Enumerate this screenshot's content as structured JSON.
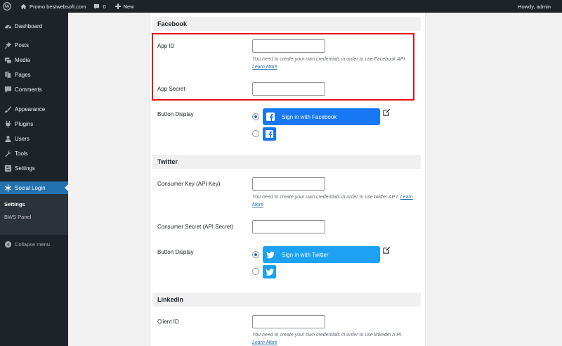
{
  "adminbar": {
    "site_name": "Promo bestwebsoft.com",
    "comments_count": "0",
    "new_label": "New",
    "howdy": "Howdy, admin",
    "icons": [
      "wordpress-logo-icon",
      "home-icon",
      "comment-icon",
      "plus-icon"
    ]
  },
  "sidebar": {
    "items": [
      {
        "label": "Dashboard",
        "icon": "dashboard-icon"
      },
      {
        "label": "Posts",
        "icon": "pin-icon"
      },
      {
        "label": "Media",
        "icon": "media-icon"
      },
      {
        "label": "Pages",
        "icon": "pages-icon"
      },
      {
        "label": "Comments",
        "icon": "comments-icon"
      },
      {
        "label": "Appearance",
        "icon": "brush-icon"
      },
      {
        "label": "Plugins",
        "icon": "plug-icon"
      },
      {
        "label": "Users",
        "icon": "users-icon"
      },
      {
        "label": "Tools",
        "icon": "wrench-icon"
      },
      {
        "label": "Settings",
        "icon": "settings-icon"
      },
      {
        "label": "Social Login",
        "icon": "snowflake-icon",
        "current": true
      }
    ],
    "submenu": [
      {
        "label": "Settings",
        "current": true
      },
      {
        "label": "BWS Panel"
      }
    ],
    "collapse_label": "Collapse menu"
  },
  "facebook": {
    "heading": "Facebook",
    "app_id_label": "App ID",
    "app_id_value": "",
    "description": "You need to create your own credentials in order to use Facebook API.",
    "learn_more": "Learn More",
    "app_secret_label": "App Secret",
    "app_secret_value": "",
    "button_display_label": "Button Display",
    "signin_label": "Sign in with Facebook",
    "selected_option": "long-button"
  },
  "twitter": {
    "heading": "Twitter",
    "key_label": "Consumer Key (API Key)",
    "key_value": "",
    "description": "You need to create your own credentials in order to use twitter AP I.",
    "learn_more": "Learn More",
    "secret_label": "Consumer Secret (API Secret)",
    "secret_value": "",
    "button_display_label": "Button Display",
    "signin_label": "Sign in with Twitter",
    "selected_option": "long-button"
  },
  "linkedin": {
    "heading": "LinkedIn",
    "client_id_label": "Client ID",
    "client_id_value": "",
    "description": "You need to create your own credentials in order to use linkedin A PI.",
    "learn_more": "Learn More"
  },
  "colors": {
    "adminbar_bg": "#1d2327",
    "menu_current": "#2271b1",
    "facebook_blue": "#1877f2",
    "twitter_blue": "#1da1f2",
    "highlight_red": "#e2131a"
  }
}
